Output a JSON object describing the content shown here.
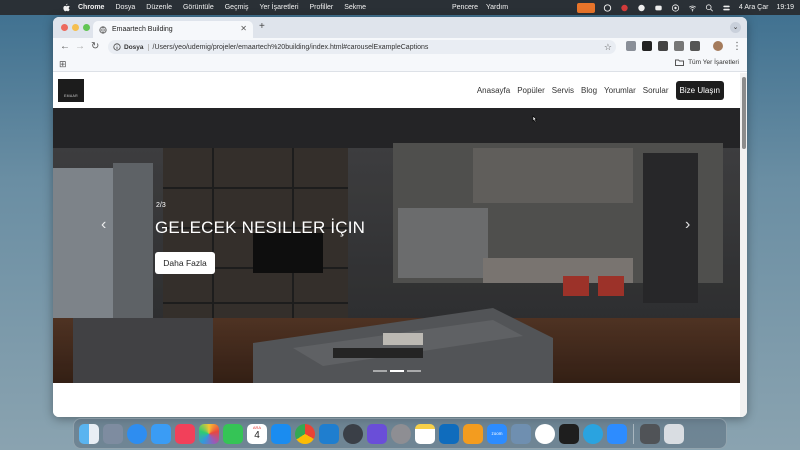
{
  "menubar": {
    "app_name": "Chrome",
    "menus": [
      "Dosya",
      "Düzenle",
      "Görüntüle",
      "Geçmiş",
      "Yer İşaretleri",
      "Profiller",
      "Sekme",
      "Pencere",
      "Yardım"
    ],
    "date": "4 Ara Çar",
    "time": "19:19"
  },
  "browser": {
    "tab_title": "Emaartech Building",
    "address_scheme_label": "Dosya",
    "url": "/Users/yeo/udemig/projeler/emaartech%20building/index.html#carouselExampleCaptions",
    "all_bookmarks_label": "Tüm Yer İşaretleri"
  },
  "site": {
    "logo_text": "EMAAR",
    "nav": [
      "Anasayfa",
      "Popüler",
      "Servis",
      "Blog",
      "Yorumlar",
      "Sorular"
    ],
    "cta_label": "Bize Ulaşın"
  },
  "carousel": {
    "counter": "2/3",
    "caption": "GELECEK NESILLER İÇIN",
    "button_label": "Daha Fazla",
    "prev_glyph": "‹",
    "next_glyph": "›",
    "slides_total": 3,
    "active_index": 1
  },
  "dock": {
    "apps": [
      "finder",
      "launchpad",
      "safari",
      "mail",
      "music",
      "photos",
      "facetime",
      "calendar",
      "app-store",
      "chrome",
      "vscode",
      "quicktime",
      "imovie",
      "system-settings",
      "notes",
      "outlook",
      "sketch",
      "zoom",
      "preview",
      "github-desktop",
      "terminal",
      "telegram",
      "zoom-alt",
      "calculator",
      "trash"
    ],
    "calendar_month": "ARA",
    "calendar_day": "4",
    "zoom_label": "zoom"
  },
  "colors": {
    "accent_cta": "#1d1d1d",
    "menubar": "#2a3036",
    "mic_indicator": "#e8742a"
  }
}
